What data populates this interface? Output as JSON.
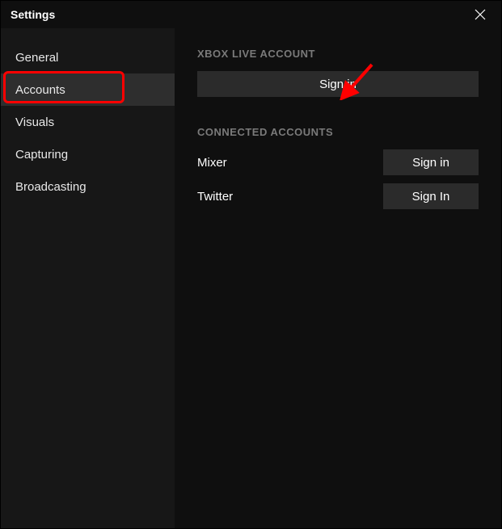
{
  "titlebar": {
    "title": "Settings"
  },
  "sidebar": {
    "items": [
      {
        "label": "General"
      },
      {
        "label": "Accounts"
      },
      {
        "label": "Visuals"
      },
      {
        "label": "Capturing"
      },
      {
        "label": "Broadcasting"
      }
    ],
    "activeIndex": 1
  },
  "main": {
    "xbox_section_title": "XBOX LIVE ACCOUNT",
    "xbox_signin_label": "Sign in",
    "connected_section_title": "CONNECTED ACCOUNTS",
    "connected": [
      {
        "name": "Mixer",
        "button": "Sign in"
      },
      {
        "name": "Twitter",
        "button": "Sign In"
      }
    ]
  },
  "annotations": {
    "highlight_accounts": true,
    "arrow_to_signin": true
  }
}
